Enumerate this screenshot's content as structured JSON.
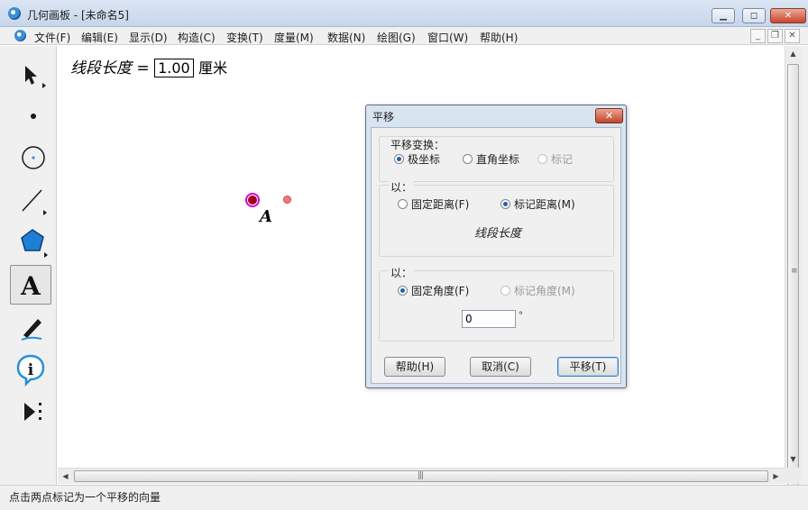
{
  "window": {
    "title": "几何画板 - [未命名5]",
    "controls": [
      "min",
      "max",
      "close"
    ]
  },
  "menu": {
    "items": [
      "文件(F)",
      "编辑(E)",
      "显示(D)",
      "构造(C)",
      "变换(T)",
      "度量(M)",
      "数据(N)",
      "绘图(G)",
      "窗口(W)",
      "帮助(H)"
    ]
  },
  "toolbox": {
    "tools": [
      "arrow-tool",
      "point-tool",
      "compass-tool",
      "straightedge-tool",
      "polygon-tool",
      "text-tool",
      "marker-tool",
      "information-tool",
      "custom-tool"
    ],
    "selected": "text-tool"
  },
  "canvas": {
    "measurement": {
      "label": "线段长度",
      "equals": "=",
      "value": "1.00",
      "unit": "厘米"
    },
    "point_label": "A"
  },
  "statusbar": {
    "text": "点击两点标记为一个平移的向量"
  },
  "dialog": {
    "title": "平移",
    "close_label": "✕",
    "group1": {
      "title": "平移变换：",
      "options": [
        "极坐标",
        "直角坐标",
        "标记"
      ],
      "selected": "极坐标"
    },
    "group2": {
      "title": "以：",
      "options": [
        "固定距离(F)",
        "标记距离(M)"
      ],
      "selected": "标记距离(M)",
      "marked_value": "线段长度"
    },
    "group3": {
      "title": "以：",
      "options": [
        "固定角度(F)",
        "标记角度(M)"
      ],
      "selected": "固定角度(F)",
      "angle_value": "0",
      "angle_unit": "°"
    },
    "buttons": {
      "help": "帮助(H)",
      "cancel": "取消(C)",
      "ok": "平移(T)"
    }
  },
  "colors": {
    "accent": "#2a5ea8",
    "point_selected_ring": "#d400d4",
    "point_a": "#a00018",
    "point_b": "#f07a7a"
  }
}
